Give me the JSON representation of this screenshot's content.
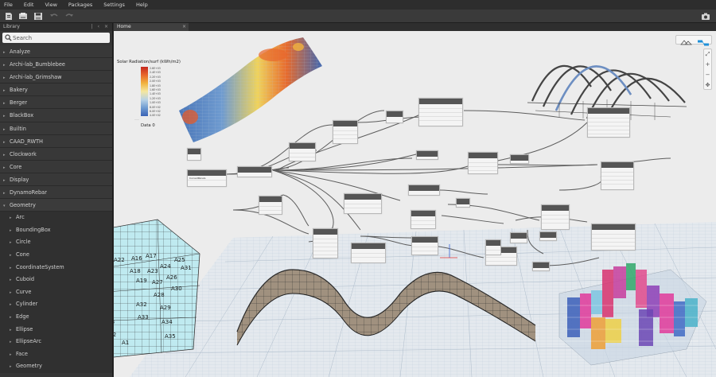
{
  "menu": [
    "File",
    "Edit",
    "View",
    "Packages",
    "Settings",
    "Help"
  ],
  "library": {
    "title": "Library",
    "controls": "| ‹ ×",
    "search_placeholder": "Search",
    "categories": [
      "Analyze",
      "Archi-lab_Bumblebee",
      "Archi-lab_Grimshaw",
      "Bakery",
      "Berger",
      "BlackBox",
      "Builtin",
      "CAAD_RWTH",
      "Clockwork",
      "Core",
      "Display",
      "DynamoRebar"
    ],
    "open_category": "Geometry",
    "subcategories": [
      "Arc",
      "BoundingBox",
      "Circle",
      "Cone",
      "CoordinateSystem",
      "Cuboid",
      "Curve",
      "Cylinder",
      "Edge",
      "Ellipse",
      "EllipseArc",
      "Face",
      "Geometry"
    ]
  },
  "tabs": {
    "home": "Home",
    "close": "×"
  },
  "canvas": {
    "zoom": [
      "⤢",
      "+",
      "−",
      "✥"
    ],
    "code_block_label": "CurvedPanels",
    "legend": {
      "title": "Solar Radiation/surf (kWh/m2)",
      "ticks": [
        "2.6E+03",
        "2.4E+03",
        "2.2E+03",
        "2.0E+03",
        "1.8E+03",
        "1.6E+03",
        "1.4E+03",
        "1.2E+03",
        "1.0E+03",
        "8.0E+02",
        "6.0E+02",
        "4.0E+02"
      ],
      "subcaption": "......",
      "data_label": "Data 0"
    },
    "panel_labels": [
      "A20",
      "A15",
      "A21",
      "A22",
      "A14",
      "A16",
      "A13",
      "A17",
      "A10",
      "A12",
      "A18",
      "A11",
      "A25",
      "A24",
      "A23",
      "A19",
      "A9",
      "A8",
      "A7",
      "A6",
      "A26",
      "A5",
      "A31",
      "A27",
      "A4",
      "A30",
      "A28",
      "A3",
      "A32",
      "A29",
      "A2",
      "A33",
      "A1",
      "A34",
      "A35"
    ]
  },
  "colors": {
    "menubar": "#2d2d2d",
    "toolbar": "#3a3a3a",
    "library": "#353535",
    "canvas": "#ececec",
    "node_header": "#555555"
  }
}
